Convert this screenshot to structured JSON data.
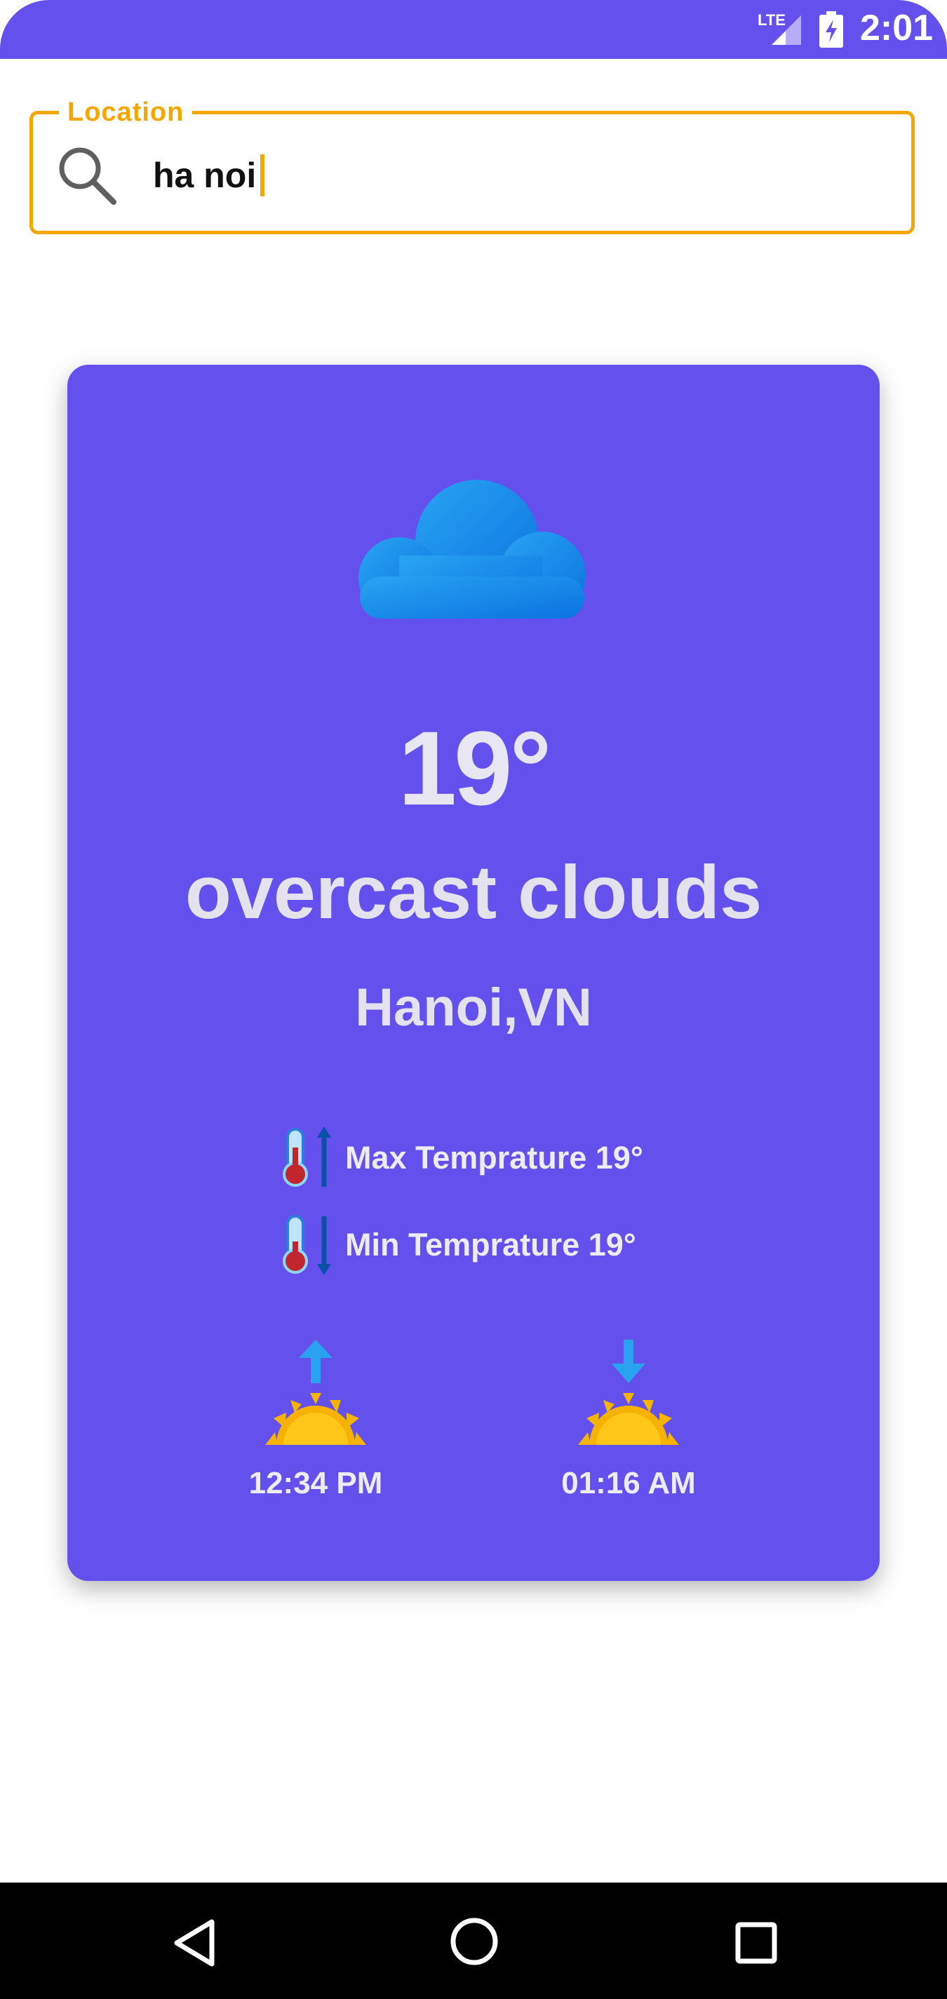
{
  "status_bar": {
    "network": "LTE",
    "time": "2:01"
  },
  "search": {
    "label": "Location",
    "value": "ha noi",
    "icon": "search-icon"
  },
  "weather": {
    "icon": "cloud-icon",
    "temperature": "19°",
    "description": "overcast clouds",
    "location": "Hanoi,VN",
    "max_label": "Max Temprature 19°",
    "min_label": "Min Temprature 19°",
    "sunrise_time": "12:34 PM",
    "sunset_time": "01:16 AM"
  },
  "colors": {
    "primary": "#6450EC",
    "accent": "#F5A700",
    "cloud": "#1E8BEA",
    "sun": "#F7B500"
  },
  "nav": {
    "back": "back-icon",
    "home": "home-icon",
    "recents": "recents-icon"
  }
}
